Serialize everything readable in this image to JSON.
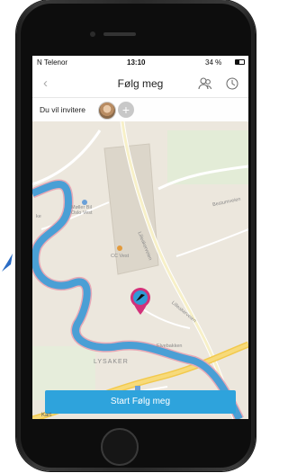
{
  "status": {
    "carrier": "N Telenor",
    "time": "13:10",
    "battery": "34 %"
  },
  "nav": {
    "title": "Følg meg",
    "back_icon": "chevron-left-icon",
    "contacts_icon": "contacts-icon",
    "history_icon": "clock-icon"
  },
  "invite": {
    "label": "Du vil invitere",
    "add_icon": "plus-icon"
  },
  "map_labels": {
    "meller": "Møller Bil\nOslo Vest",
    "cc": "CC Vest",
    "lilleaker1": "Lilleakerveien",
    "lilleaker2": "Lilleakerveien",
    "lysaker": "LYSAKER",
    "elvebakken": "Elvebakken",
    "bestumvei": "Bestumveien",
    "ke": "ke"
  },
  "actions": {
    "start": "Start Følg meg"
  },
  "map_attribution": "Kart",
  "colors": {
    "accent": "#2ea3dc",
    "pin": "#d2317a",
    "river": "#4a9fd5",
    "highway": "#f2c94c"
  }
}
